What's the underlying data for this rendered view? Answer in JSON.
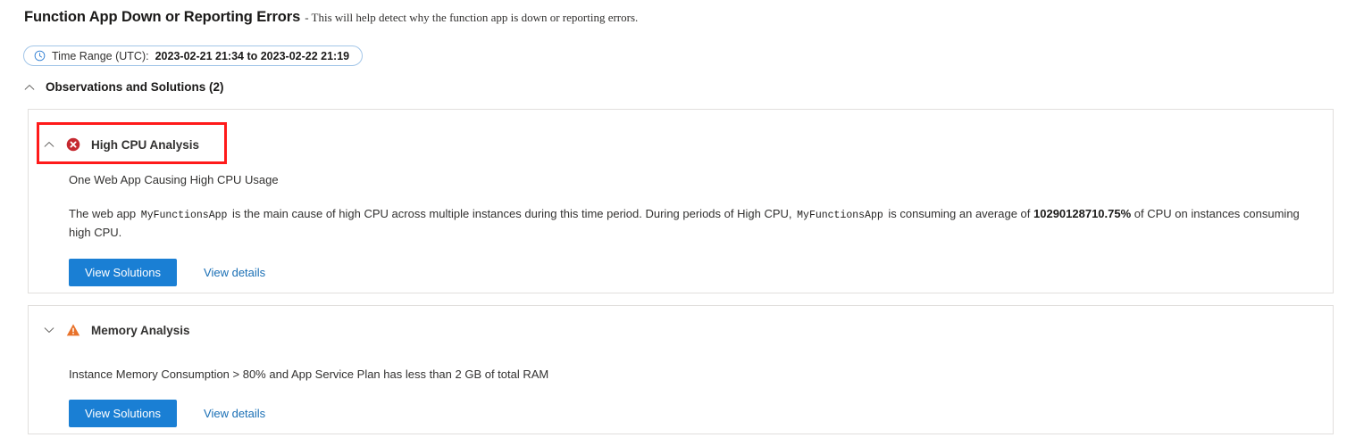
{
  "header": {
    "title": "Function App Down or Reporting Errors",
    "separator": "-",
    "description": "This will help detect why the function app is down or reporting errors."
  },
  "time_range": {
    "icon": "clock-icon",
    "label": "Time Range (UTC):",
    "value": "2023-02-21 21:34 to 2023-02-22 21:19"
  },
  "section": {
    "chevron": "chevron-up-icon",
    "title": "Observations and Solutions (2)"
  },
  "cards": [
    {
      "id": "cpu",
      "chevron": "chevron-up-icon",
      "status_icon": "error-circle-icon",
      "status_color": "#c5282f",
      "title": "High CPU Analysis",
      "summary": "One Web App Causing High CPU Usage",
      "detail": {
        "part1": "The web app",
        "app_name_1": "MyFunctionsApp",
        "part2": "is the main cause of high CPU across multiple instances during this time period. During periods of High CPU,",
        "app_name_2": "MyFunctionsApp",
        "part3": "is consuming an average of",
        "value": "10290128710.75%",
        "part4": "of CPU on instances consuming high CPU."
      },
      "primary_button": "View Solutions",
      "details_link": "View details",
      "highlighted": true
    },
    {
      "id": "mem",
      "chevron": "chevron-down-icon",
      "status_icon": "warning-triangle-icon",
      "status_color": "#e8722a",
      "title": "Memory Analysis",
      "summary": "Instance Memory Consumption > 80% and App Service Plan has less than 2 GB of total RAM",
      "primary_button": "View Solutions",
      "details_link": "View details",
      "highlighted": false
    }
  ],
  "colors": {
    "accent_blue": "#1a7fd4",
    "link_blue": "#1a6fb5",
    "error_red": "#c5282f",
    "warning_orange": "#e8722a",
    "highlight_red": "#ff1a1a",
    "card_border": "#e1dfdd",
    "pill_border": "#a3c6e8"
  }
}
